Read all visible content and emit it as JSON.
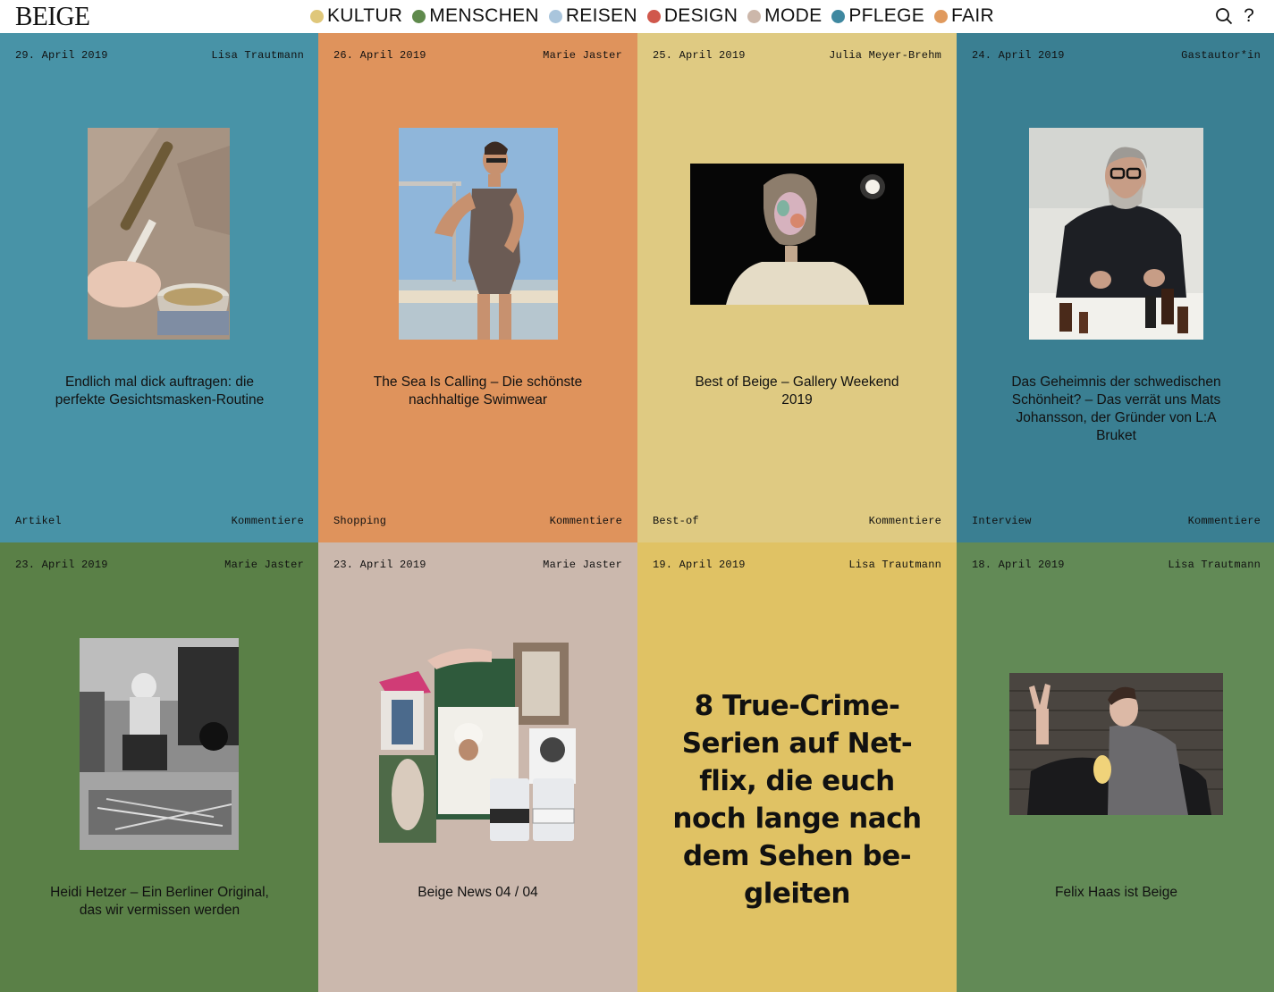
{
  "header": {
    "logo": "BEIGE",
    "nav": [
      {
        "label": "KULTUR",
        "color": "#dfc77a"
      },
      {
        "label": "MENSCHEN",
        "color": "#5f8a4c"
      },
      {
        "label": "REISEN",
        "color": "#a9c5dc"
      },
      {
        "label": "DESIGN",
        "color": "#d0584c"
      },
      {
        "label": "MODE",
        "color": "#ccb7aa"
      },
      {
        "label": "PFLEGE",
        "color": "#3f88a0"
      },
      {
        "label": "FAIR",
        "color": "#e09a5e"
      }
    ],
    "search_icon": "search-icon",
    "help_label": "?"
  },
  "cards": [
    {
      "date": "29. April 2019",
      "author": "Lisa Trautmann",
      "title": "Endlich mal dick auftragen: die perfekte Gesichtsmasken-Routine",
      "category": "Artikel",
      "comment": "Kommentiere",
      "bg": "#4893a7",
      "image": "face-mask-brush-photo"
    },
    {
      "date": "26. April 2019",
      "author": "Marie Jaster",
      "title": "The Sea Is Calling – Die schönste nachhaltige Swimwear",
      "category": "Shopping",
      "comment": "Kommentiere",
      "bg": "#df935c",
      "image": "swimwear-photo"
    },
    {
      "date": "25. April 2019",
      "author": "Julia Meyer-Brehm",
      "title": "Best of Beige – Gallery Weekend 2019",
      "category": "Best-of",
      "comment": "Kommentiere",
      "bg": "#dfca82",
      "image": "gallery-weekend-photo"
    },
    {
      "date": "24. April 2019",
      "author": "Gastautor*in",
      "title": "Das Geheimnis der schwedischen Schönheit? – Das verrät uns Mats Johansson, der Gründer von L:A Bruket",
      "category": "Interview",
      "comment": "Kommentiere",
      "bg": "#3a7f92",
      "image": "mats-johansson-photo"
    },
    {
      "date": "23. April 2019",
      "author": "Marie Jaster",
      "title": "Heidi Hetzer – Ein Berliner Original, das wir vermissen werden",
      "bg": "#5a8047",
      "image": "heidi-hetzer-photo"
    },
    {
      "date": "23. April 2019",
      "author": "Marie Jaster",
      "title": "Beige News 04 / 04",
      "bg": "#cbb8ad",
      "image": "beige-news-collage"
    },
    {
      "date": "19. April 2019",
      "author": "Lisa Trautmann",
      "title": "8 True-Crime-Serien auf Net-flix, die euch noch lange nach dem Sehen be-gleiten",
      "bg": "#e0c264"
    },
    {
      "date": "18. April 2019",
      "author": "Lisa Trautmann",
      "title": "Felix Haas ist Beige",
      "bg": "#628a56",
      "image": "felix-haas-photo"
    }
  ]
}
